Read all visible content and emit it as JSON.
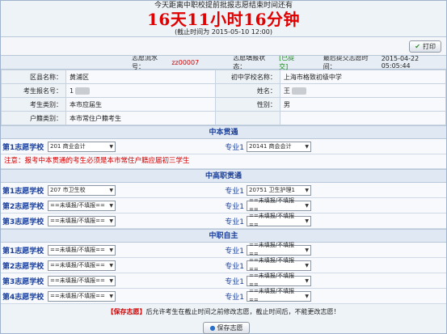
{
  "header": {
    "line1": "今天距离中职校提前批报志愿结束时间还有",
    "countdown": "16天11小时16分钟",
    "deadline": "(截止时间为 2015-05-10 12:00)"
  },
  "toolbar": {
    "print_label": "打印",
    "print_icon": "check-icon"
  },
  "status": {
    "serial_label": "志愿流水号：",
    "serial_value": "zz00007",
    "state_label": "志愿填报状态：",
    "state_value": "[已提交]",
    "last_label": "最后提交志愿时间：",
    "last_value": "2015-04-22 05:05:44"
  },
  "info": {
    "district_label": "区县名称：",
    "district_value": "黄浦区",
    "school_label": "初中学校名称：",
    "school_value": "上海市格致初级中学",
    "regno_label": "考生报名号：",
    "regno_value": "1",
    "name_label": "姓名：",
    "name_value": "王",
    "cat_label": "考生类别：",
    "cat_value": "本市应届生",
    "gender_label": "性别：",
    "gender_value": "男",
    "hukou_label": "户籍类别：",
    "hukou_value": "本市常住户籍考生"
  },
  "sections": {
    "s1": "中本贯通",
    "s2": "中高职贯通",
    "s3": "中职自主"
  },
  "labels": {
    "first": "第1志愿学校",
    "second": "第2志愿学校",
    "third": "第3志愿学校",
    "fourth": "第4志愿学校",
    "major1": "专业1"
  },
  "zhongben": {
    "school": "201 商业会计",
    "major": "20141 商会会计"
  },
  "note": "注意：报考中本贯通的考生必须是本市常住户籍应届初三学生",
  "zhonggao": [
    {
      "school": "207 市卫生校",
      "major": "20751 卫生护理1"
    },
    {
      "school": "==未填报/不填报==",
      "major": "==未填报/不填报=="
    },
    {
      "school": "==未填报/不填报==",
      "major": "==未填报/不填报=="
    }
  ],
  "zhongzhi": [
    {
      "school": "==未填报/不填报==",
      "major": "==未填报/不填报=="
    },
    {
      "school": "==未填报/不填报==",
      "major": "==未填报/不填报=="
    },
    {
      "school": "==未填报/不填报==",
      "major": "==未填报/不填报=="
    },
    {
      "school": "==未填报/不填报==",
      "major": "==未填报/不填报=="
    }
  ],
  "footer": {
    "save_tag": "【保存志愿】",
    "note": "后允许考生在截止时间之前修改志愿，截止时间后，不能更改志愿！",
    "save_label": "保存志愿"
  },
  "colors": {
    "accent_red": "#e00000",
    "label_blue": "#1a3f9c",
    "status_green": "#108a10"
  }
}
